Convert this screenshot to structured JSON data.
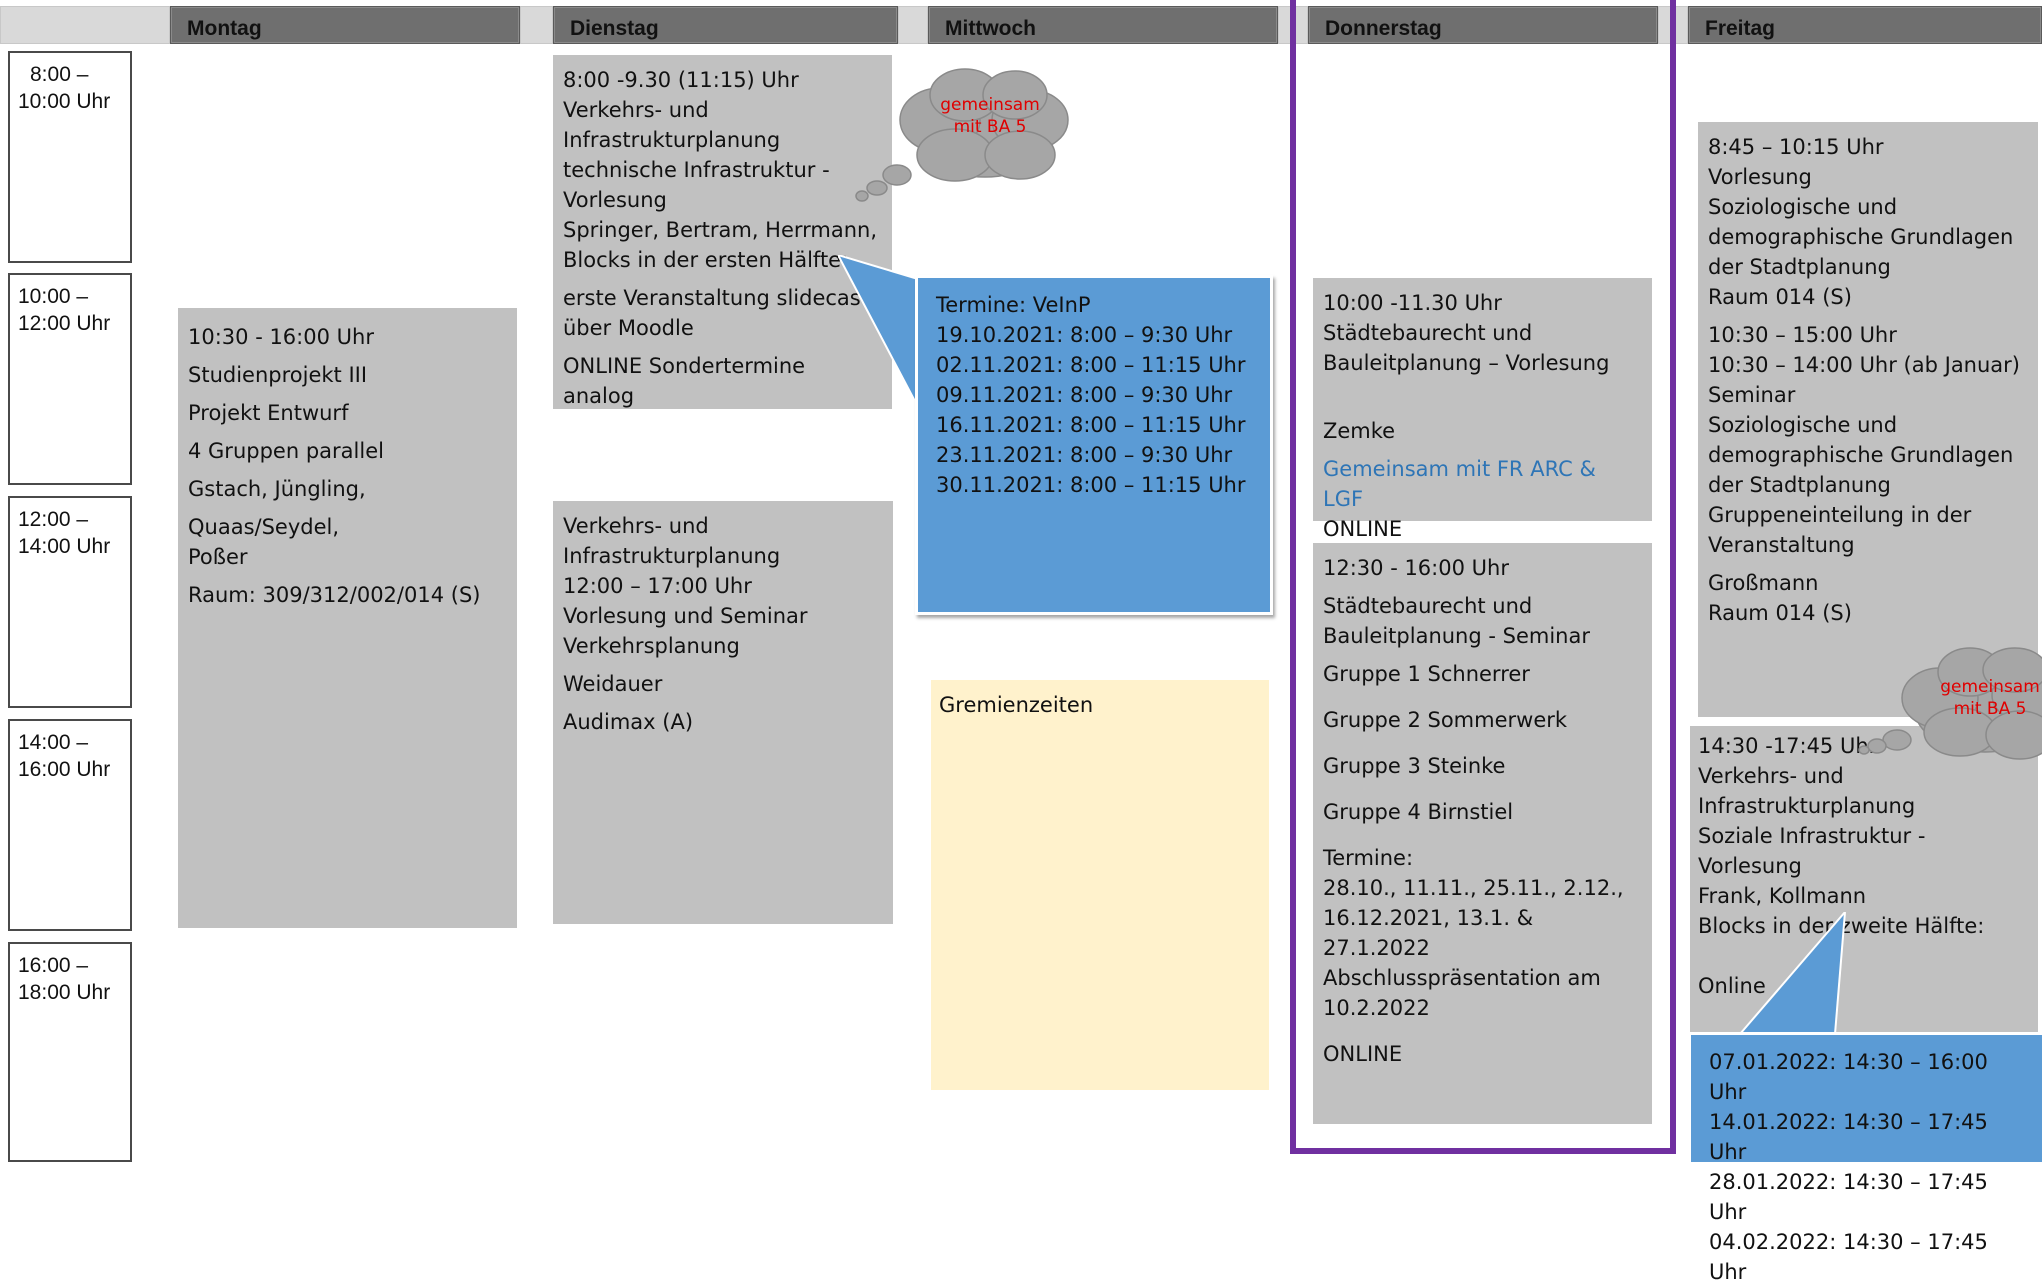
{
  "header": {
    "days": [
      "Montag",
      "Dienstag",
      "Mittwoch",
      "Donnerstag",
      "Freitag"
    ]
  },
  "times": [
    {
      "from": "8:00 –",
      "to": "10:00 Uhr"
    },
    {
      "from": "10:00 –",
      "to": "12:00 Uhr"
    },
    {
      "from": "12:00 –",
      "to": "14:00 Uhr"
    },
    {
      "from": "14:00 –",
      "to": "16:00 Uhr"
    },
    {
      "from": "16:00 –",
      "to": "18:00 Uhr"
    }
  ],
  "montag": {
    "lines": [
      "10:30 - 16:00 Uhr",
      "Studienprojekt III",
      "Projekt Entwurf",
      "4 Gruppen parallel",
      "Gstach, Jüngling, Quaas/Seydel,",
      "Poßer",
      "Raum: 309/312/002/014 (S)"
    ]
  },
  "dienstag": {
    "box1": [
      "8:00 -9.30 (11:15) Uhr",
      "Verkehrs- und",
      "Infrastrukturplanung",
      "technische Infrastruktur -",
      "Vorlesung",
      "Springer, Bertram, Herrmann,",
      "Blocks in der ersten Hälfte:",
      "erste Veranstaltung slidecast",
      "über Moodle",
      "ONLINE Sondertermine analog"
    ],
    "box2": [
      "Verkehrs- und",
      "Infrastrukturplanung",
      "12:00 – 17:00 Uhr",
      "Vorlesung und Seminar",
      "Verkehrsplanung",
      "Weidauer",
      "Audimax (A)"
    ],
    "cloud": [
      "gemeinsam",
      "mit BA 5"
    ]
  },
  "mittwoch": {
    "termine": [
      "Termine: VeInP",
      "19.10.2021: 8:00 – 9:30 Uhr",
      "02.11.2021: 8:00 – 11:15 Uhr",
      "09.11.2021: 8:00 – 9:30 Uhr",
      "16.11.2021: 8:00 – 11:15 Uhr",
      "23.11.2021: 8:00 – 9:30 Uhr",
      "30.11.2021: 8:00 – 11:15 Uhr"
    ],
    "gremien": "Gremienzeiten"
  },
  "donnerstag": {
    "box1": [
      "10:00 -11.30 Uhr",
      "Städtebaurecht und",
      "Bauleitplanung – Vorlesung",
      "Zemke",
      "Gemeinsam mit FR ARC & LGF",
      "ONLINE"
    ],
    "box2": [
      "12:30 - 16:00 Uhr",
      "Städtebaurecht und",
      "Bauleitplanung - Seminar",
      "Gruppe 1 Schnerrer",
      "Gruppe 2 Sommerwerk",
      "Gruppe 3 Steinke",
      "Gruppe 4 Birnstiel",
      "Termine:",
      "28.10., 11.11., 25.11., 2.12.,",
      "16.12.2021, 13.1. & 27.1.2022",
      "Abschlusspräsentation am",
      "10.2.2022",
      "ONLINE"
    ]
  },
  "freitag": {
    "box1": [
      "8:45 – 10:15 Uhr",
      "Vorlesung",
      "Soziologische und",
      "demographische Grundlagen",
      "der Stadtplanung",
      "Raum 014 (S)",
      "10:30 – 15:00 Uhr",
      "10:30 – 14:00 Uhr (ab Januar)",
      "Seminar",
      "Soziologische und",
      "demographische Grundlagen",
      "der Stadtplanung",
      "Gruppeneinteilung in der",
      "Veranstaltung",
      "Großmann",
      "Raum 014 (S)"
    ],
    "box2": [
      "14:30 -17:45 Uhr",
      "Verkehrs- und",
      "Infrastrukturplanung",
      "Soziale Infrastruktur - Vorlesung",
      "Frank, Kollmann",
      "Blocks in der zweite Hälfte:",
      "Online"
    ],
    "termine": [
      "07.01.2022: 14:30 – 16:00 Uhr",
      "14.01.2022: 14:30 – 17:45 Uhr",
      "28.01.2022: 14:30 – 17:45 Uhr",
      "04.02.2022: 14:30 – 17:45 Uhr"
    ],
    "cloud": [
      "gemeinsam",
      "mit BA 5"
    ]
  },
  "colors": {
    "header": "#6f6f6f",
    "box": "#c1c1c1",
    "blue": "#5b9bd5",
    "cream": "#fff2cc",
    "highlight_frame": "#7030a0",
    "cloud": "#a6a6a6",
    "cloud_text": "#e00000",
    "link": "#2e75b6"
  }
}
